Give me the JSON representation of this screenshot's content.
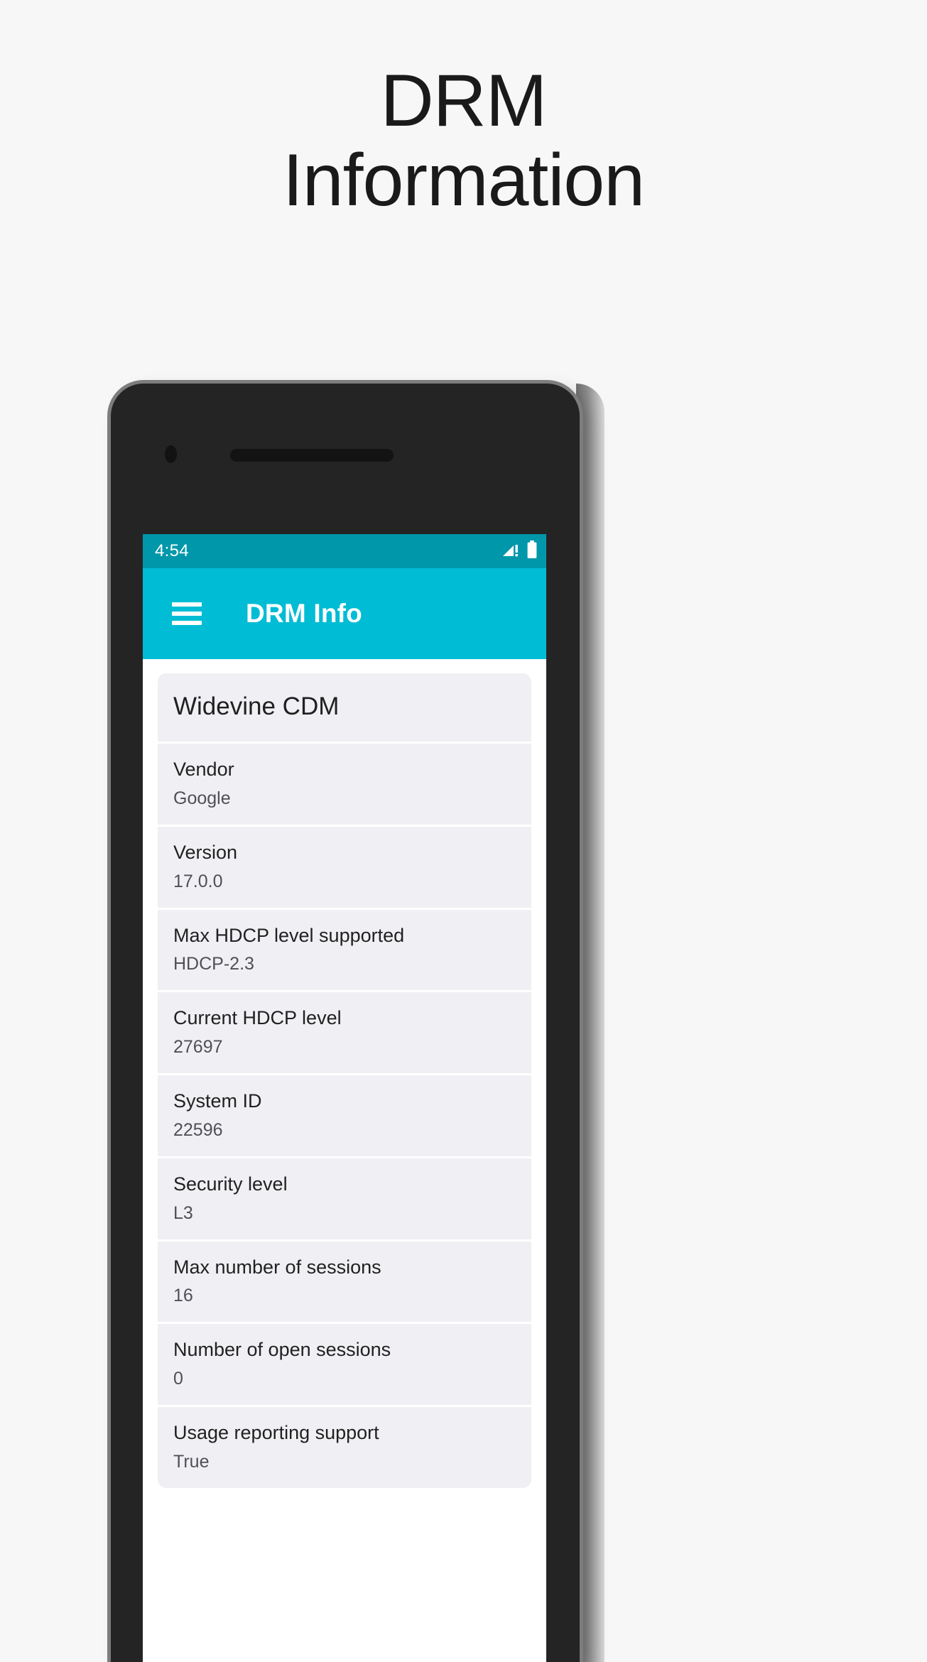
{
  "headline": {
    "line1": "DRM",
    "line2": "Information"
  },
  "phone": {
    "camera_icon": "front-camera",
    "speaker_icon": "earpiece-speaker",
    "power_button": "power-button",
    "volume_button": "volume-rocker"
  },
  "statusbar": {
    "time": "4:54",
    "signal_icon": "signal-no-service-icon",
    "battery_icon": "battery-full-icon",
    "background": "#0097ab"
  },
  "appbar": {
    "menu_icon": "hamburger-menu-icon",
    "title": "DRM Info",
    "background": "#00bcd4"
  },
  "card": {
    "header": "Widevine CDM",
    "background": "#f0f0f4",
    "rows": [
      {
        "label": "Vendor",
        "value": "Google"
      },
      {
        "label": "Version",
        "value": "17.0.0"
      },
      {
        "label": "Max HDCP level supported",
        "value": "HDCP-2.3"
      },
      {
        "label": "Current HDCP level",
        "value": "27697"
      },
      {
        "label": "System ID",
        "value": "22596"
      },
      {
        "label": "Security level",
        "value": "L3"
      },
      {
        "label": "Max number of sessions",
        "value": "16"
      },
      {
        "label": "Number of open sessions",
        "value": "0"
      },
      {
        "label": "Usage reporting support",
        "value": "True"
      }
    ]
  }
}
